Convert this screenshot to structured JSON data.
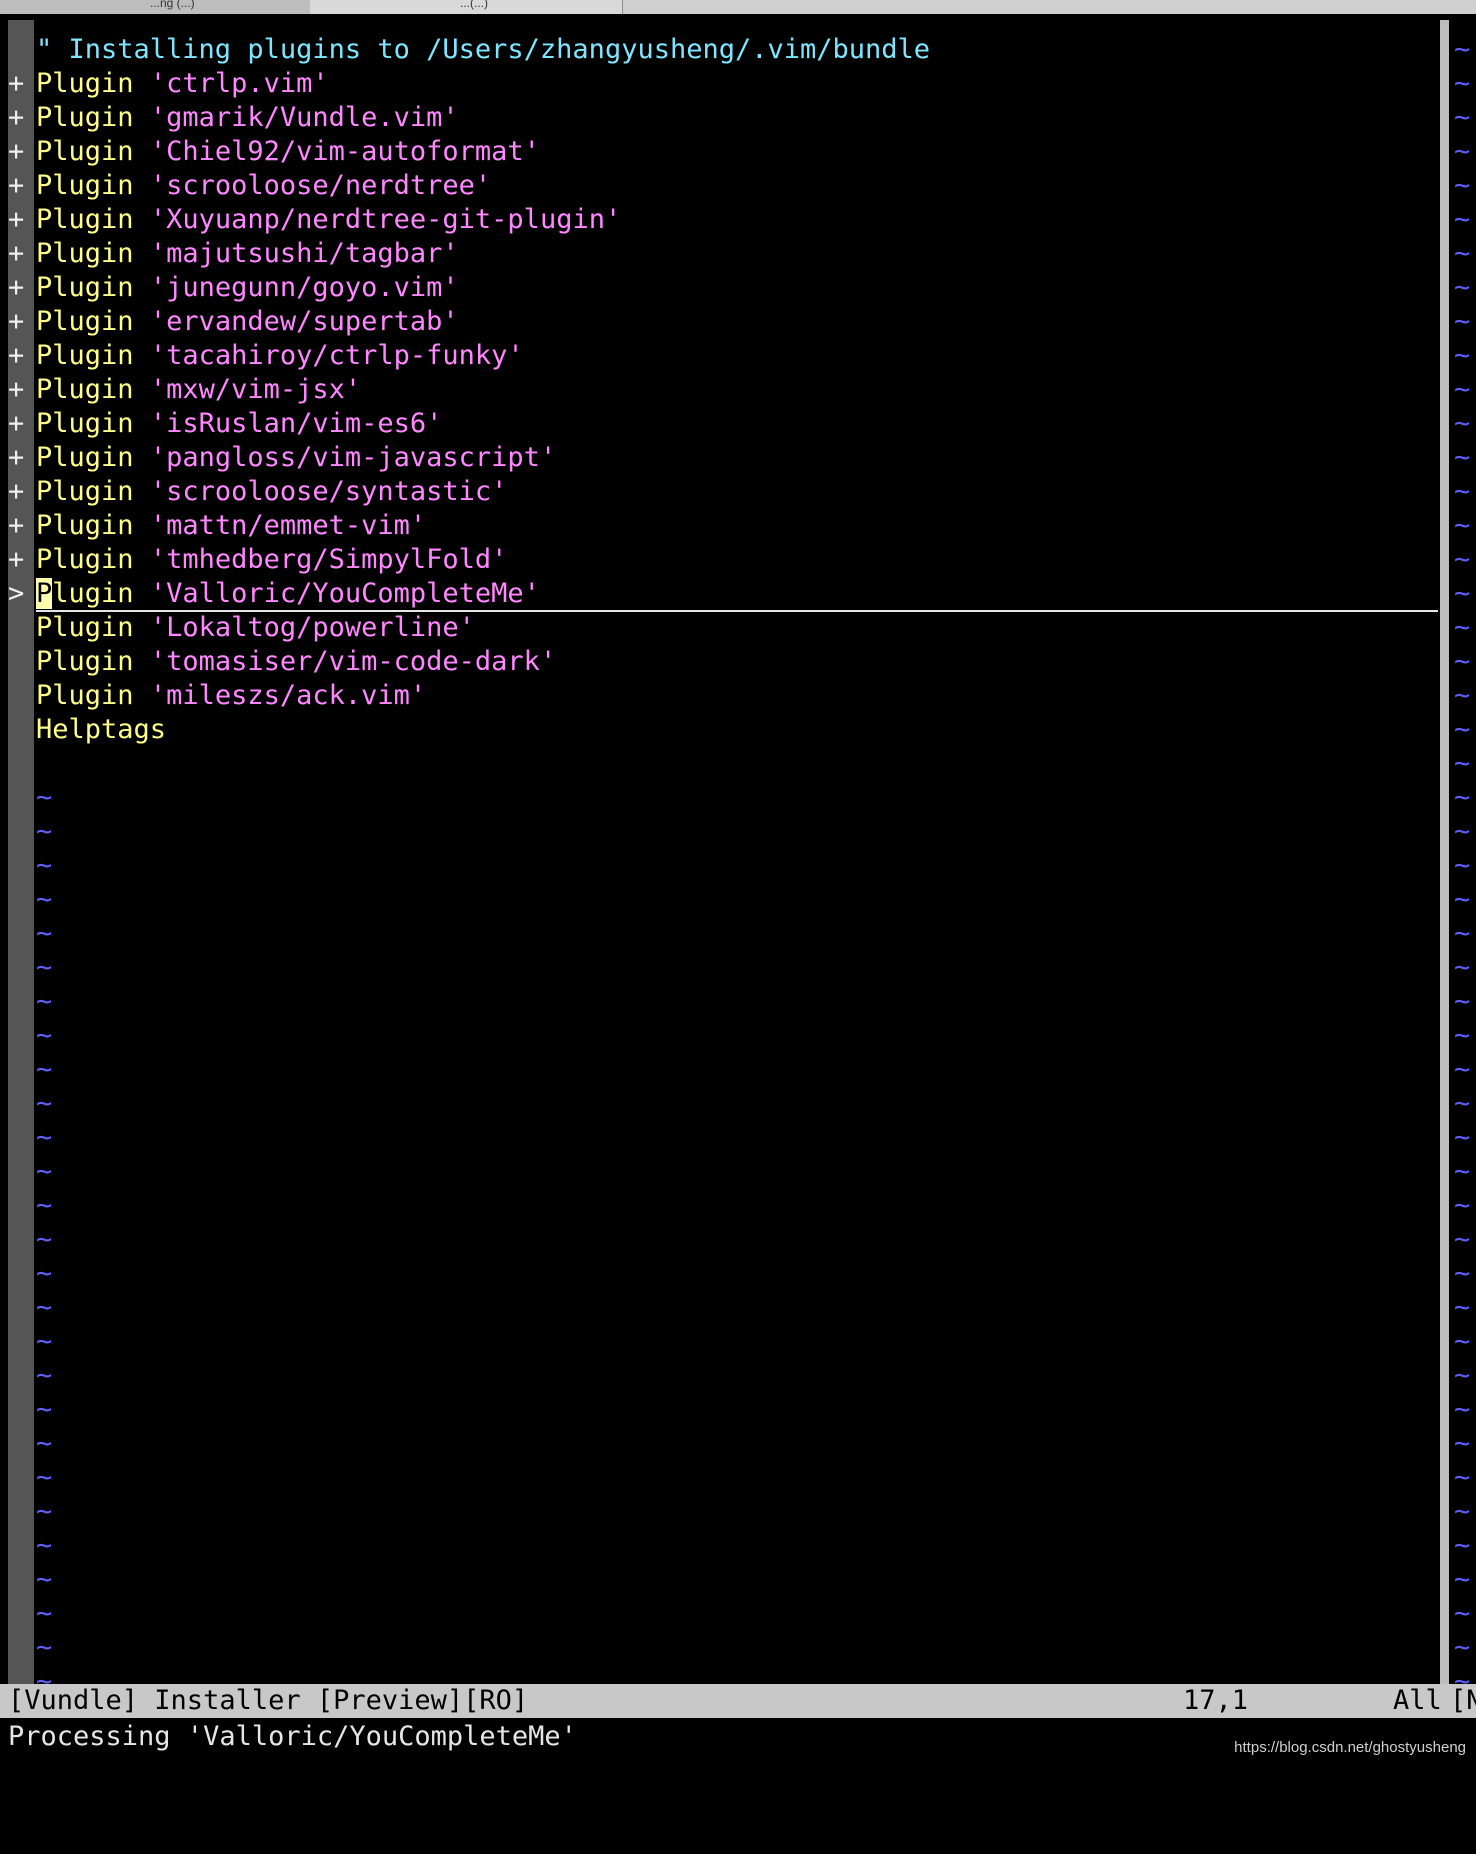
{
  "tabs": [
    {
      "label": "...ng (...)",
      "active": true
    },
    {
      "label": "...(...)",
      "active": false
    }
  ],
  "header_comment": "\" Installing plugins to /Users/zhangyusheng/.vim/bundle",
  "plugins": [
    {
      "sign": "+",
      "keyword": "Plugin",
      "name": "'ctrlp.vim'"
    },
    {
      "sign": "+",
      "keyword": "Plugin",
      "name": "'gmarik/Vundle.vim'"
    },
    {
      "sign": "+",
      "keyword": "Plugin",
      "name": "'Chiel92/vim-autoformat'"
    },
    {
      "sign": "+",
      "keyword": "Plugin",
      "name": "'scrooloose/nerdtree'"
    },
    {
      "sign": "+",
      "keyword": "Plugin",
      "name": "'Xuyuanp/nerdtree-git-plugin'"
    },
    {
      "sign": "+",
      "keyword": "Plugin",
      "name": "'majutsushi/tagbar'"
    },
    {
      "sign": "+",
      "keyword": "Plugin",
      "name": "'junegunn/goyo.vim'"
    },
    {
      "sign": "+",
      "keyword": "Plugin",
      "name": "'ervandew/supertab'"
    },
    {
      "sign": "+",
      "keyword": "Plugin",
      "name": "'tacahiroy/ctrlp-funky'"
    },
    {
      "sign": "+",
      "keyword": "Plugin",
      "name": "'mxw/vim-jsx'"
    },
    {
      "sign": "+",
      "keyword": "Plugin",
      "name": "'isRuslan/vim-es6'"
    },
    {
      "sign": "+",
      "keyword": "Plugin",
      "name": "'pangloss/vim-javascript'"
    },
    {
      "sign": "+",
      "keyword": "Plugin",
      "name": "'scrooloose/syntastic'"
    },
    {
      "sign": "+",
      "keyword": "Plugin",
      "name": "'mattn/emmet-vim'"
    },
    {
      "sign": "+",
      "keyword": "Plugin",
      "name": "'tmhedberg/SimpylFold'"
    },
    {
      "sign": ">",
      "keyword": "Plugin",
      "name": "'Valloric/YouCompleteMe'",
      "current": true
    },
    {
      "sign": "",
      "keyword": "Plugin",
      "name": "'Lokaltog/powerline'"
    },
    {
      "sign": "",
      "keyword": "Plugin",
      "name": "'tomasiser/vim-code-dark'"
    },
    {
      "sign": "",
      "keyword": "Plugin",
      "name": "'mileszs/ack.vim'"
    }
  ],
  "helptags_label": "Helptags",
  "tilde_char": "~",
  "status": {
    "left": "[Vundle] Installer [Preview][RO]",
    "position": "17,1",
    "scroll": "All",
    "right_truncated": "[N"
  },
  "command_line": "Processing 'Valloric/YouCompleteMe'",
  "watermark": "https://blog.csdn.net/ghostyusheng",
  "colors": {
    "background": "#000000",
    "comment": "#7fe6ff",
    "keyword": "#ffff87",
    "string": "#ff87ff",
    "tilde": "#5f5fff",
    "statusline_bg": "#c8c8c8"
  }
}
